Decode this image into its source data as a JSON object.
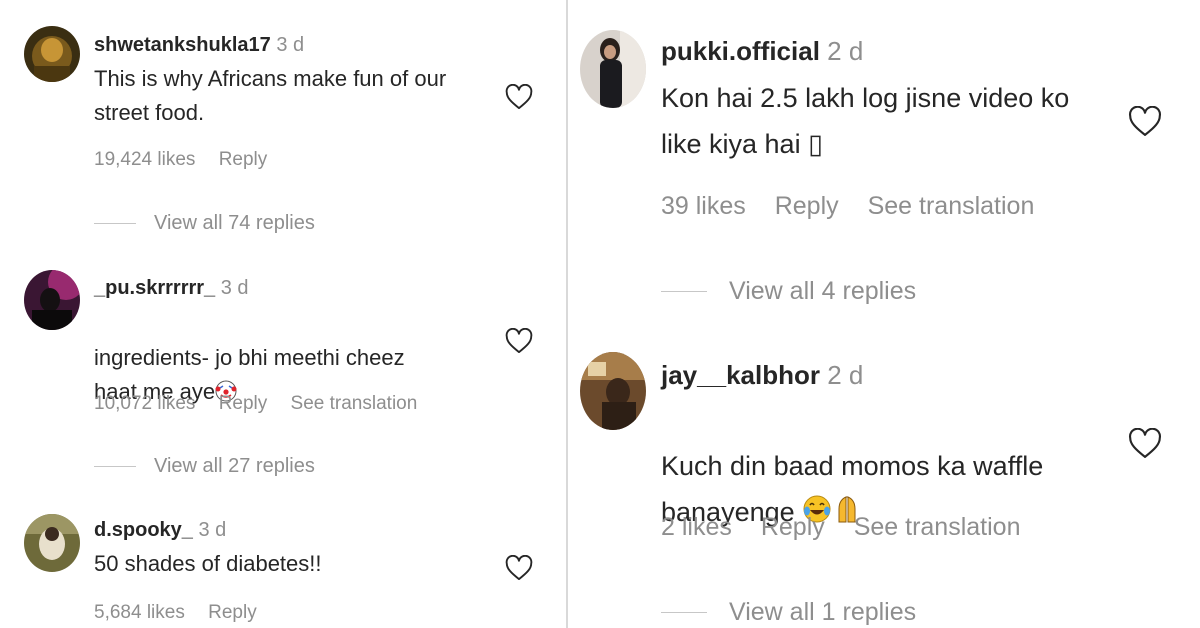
{
  "left_comments": [
    {
      "username": "shwetankshukla17",
      "time": "3 d",
      "text": "This is why Africans make fun of our\nstreet food.",
      "likes": "19,424 likes",
      "reply": "Reply",
      "see_translation": "",
      "view_replies": "View all 74 replies"
    },
    {
      "username": "_pu.skrrrrrr_",
      "time": "3 d",
      "text": "ingredients- jo bhi meethi cheez\nhaat me aye",
      "likes": "10,072 likes",
      "reply": "Reply",
      "see_translation": "See translation",
      "view_replies": "View all 27 replies"
    },
    {
      "username": "d.spooky_",
      "time": "3 d",
      "text": "50 shades of diabetes!!",
      "likes": "5,684 likes",
      "reply": "Reply",
      "see_translation": "",
      "view_replies": ""
    }
  ],
  "right_comments": [
    {
      "username": "pukki.official",
      "time": "2 d",
      "text": "Kon hai 2.5 lakh log jisne video ko\nlike kiya hai ▯",
      "likes": "39 likes",
      "reply": "Reply",
      "see_translation": "See translation",
      "view_replies": "View all 4 replies"
    },
    {
      "username": "jay__kalbhor",
      "time": "2 d",
      "text": "Kuch din baad momos ka waffle\nbanayenge",
      "likes": "2 likes",
      "reply": "Reply",
      "see_translation": "See translation",
      "view_replies": "View all 1 replies"
    }
  ],
  "icons": {
    "heart": "heart-outline-icon",
    "clown": "clown-face-emoji-icon",
    "laughing": "face-with-tears-of-joy-emoji-icon",
    "folded_hands": "folded-hands-emoji-icon"
  },
  "colors": {
    "text": "#262626",
    "secondary": "#8e8e8e",
    "divider": "#d9d9d9"
  }
}
